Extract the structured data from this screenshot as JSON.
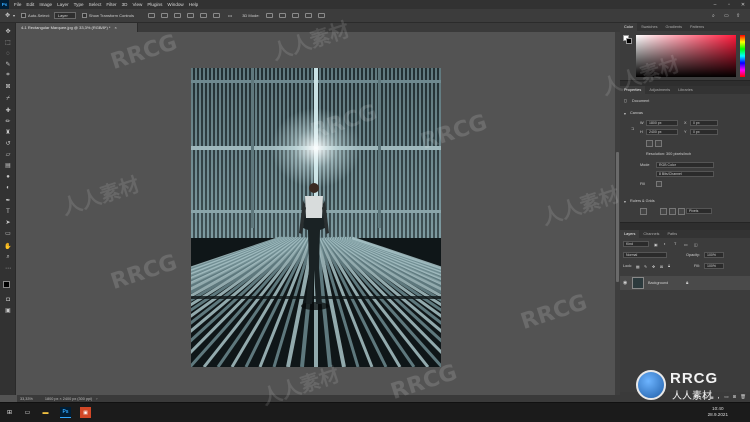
{
  "app": {
    "logo_label": "Ps",
    "menu": [
      "File",
      "Edit",
      "Image",
      "Layer",
      "Type",
      "Select",
      "Filter",
      "3D",
      "View",
      "Plugins",
      "Window",
      "Help"
    ]
  },
  "options": {
    "auto_select_label": "Auto-Select:",
    "layer_value": "Layer",
    "show_transform_label": "Show Transform Controls",
    "mode_label": "3D Mode:"
  },
  "document": {
    "tab_title": "4-1 Rectangular Marquee.jpg @ 33,3% (RGB/8*) *",
    "close_glyph": "×"
  },
  "status": {
    "zoom": "33,33%",
    "size": "1800 px × 2400 px (300 ppi)"
  },
  "panels": {
    "color": {
      "tabs": [
        "Color",
        "Swatches",
        "Gradients",
        "Patterns"
      ]
    },
    "properties": {
      "tabs": [
        "Properties",
        "Adjustments",
        "Libraries"
      ],
      "doc_label": "Document",
      "canvas_heading": "Canvas",
      "w_label": "W",
      "w_value": "1800 px",
      "h_label": "H",
      "h_value": "2400 px",
      "x_label": "X",
      "x_value": "0 px",
      "y_label": "Y",
      "y_value": "0 px",
      "resolution": "Resolution: 300 pixels/inch",
      "mode_label": "Mode",
      "mode_value": "RGB Color",
      "depth_value": "8 Bits/Channel",
      "fill_label": "Fill",
      "rulers_heading": "Rulers & Grids",
      "units_value": "Pixels"
    },
    "layers": {
      "tabs": [
        "Layers",
        "Channels",
        "Paths"
      ],
      "kind_label": "Kind",
      "blend_value": "Normal",
      "opacity_label": "Opacity:",
      "opacity_value": "100%",
      "lock_label": "Lock:",
      "fill_label": "Fill:",
      "fill_value": "100%",
      "layer_name": "Background"
    }
  },
  "taskbar": {
    "time": "10:40",
    "date": "28.9.2021"
  },
  "watermark": {
    "latin": "RRCG",
    "chinese": "人人素材",
    "logo_text": "RRCG",
    "logo_sub": "人人素材"
  },
  "colors": {
    "ui_dark": "#323232",
    "canvas_bg": "#535353",
    "ps_blue": "#31a8ff",
    "taskbar": "#1b1b1b"
  }
}
